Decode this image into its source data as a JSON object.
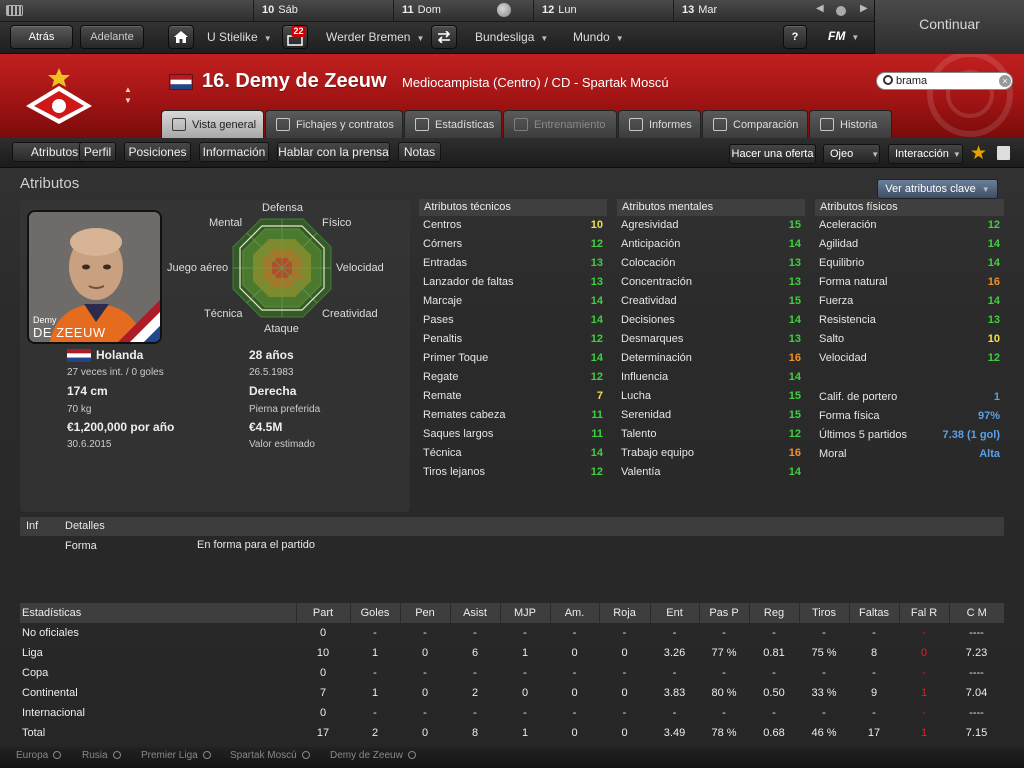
{
  "calendar": {
    "days": [
      {
        "num": "10",
        "label": "Sáb"
      },
      {
        "num": "11",
        "label": "Dom"
      },
      {
        "num": "12",
        "label": "Lun"
      },
      {
        "num": "13",
        "label": "Mar"
      }
    ]
  },
  "nav": {
    "back": "Atrás",
    "forward": "Adelante",
    "manager": "U Stielike",
    "inbox_badge": "22",
    "club": "Werder Bremen",
    "league": "Bundesliga",
    "world": "Mundo",
    "help": "?",
    "logo": "FM",
    "continue": "Continuar"
  },
  "header": {
    "title": "16. Demy de Zeeuw",
    "subtitle": "Mediocampista (Centro) / CD - Spartak Moscú",
    "search_value": "brama",
    "brand_color": "#b81818"
  },
  "tabs": [
    {
      "label": "Vista general",
      "state": "active"
    },
    {
      "label": "Fichajes y contratos",
      "state": "normal"
    },
    {
      "label": "Estadísticas",
      "state": "normal"
    },
    {
      "label": "Entrenamiento",
      "state": "disabled"
    },
    {
      "label": "Informes",
      "state": "normal"
    },
    {
      "label": "Comparación",
      "state": "normal"
    },
    {
      "label": "Historia",
      "state": "normal"
    }
  ],
  "subnav": {
    "items": [
      "Atributos",
      "Perfil",
      "Posiciones",
      "Información",
      "Hablar con la prensa",
      "Notas"
    ],
    "offer": "Hacer una oferta",
    "scout": "Ojeo",
    "interaction": "Interacción"
  },
  "section": {
    "title": "Atributos",
    "key_attr_button": "Ver atributos clave"
  },
  "profile": {
    "photo_first": "Demy",
    "photo_last": "DE ZEEUW",
    "nationality": "Holanda",
    "caps": "27 veces int. / 0 goles",
    "height": "174 cm",
    "weight": "70 kg",
    "wage": "€1,200,000 por año",
    "contract_end": "30.6.2015",
    "age": "28 años",
    "dob": "26.5.1983",
    "foot": "Derecha",
    "foot_label": "Pierna preferida",
    "value": "€4.5M",
    "value_label": "Valor estimado"
  },
  "radar": {
    "labels": {
      "defensa": "Defensa",
      "fisico": "Físico",
      "velocidad": "Velocidad",
      "creatividad": "Creatividad",
      "ataque": "Ataque",
      "tecnica": "Técnica",
      "juego_aereo": "Juego aéreo",
      "mental": "Mental"
    }
  },
  "attributes": {
    "tecnicos_title": "Atributos técnicos",
    "tecnicos": [
      {
        "name": "Centros",
        "value": "10",
        "color": "#f2e04a"
      },
      {
        "name": "Córners",
        "value": "12",
        "color": "#3fcf3f"
      },
      {
        "name": "Entradas",
        "value": "13",
        "color": "#3fcf3f"
      },
      {
        "name": "Lanzador de faltas",
        "value": "13",
        "color": "#3fcf3f"
      },
      {
        "name": "Marcaje",
        "value": "14",
        "color": "#3fcf3f"
      },
      {
        "name": "Pases",
        "value": "14",
        "color": "#3fcf3f"
      },
      {
        "name": "Penaltis",
        "value": "12",
        "color": "#3fcf3f"
      },
      {
        "name": "Primer Toque",
        "value": "14",
        "color": "#3fcf3f"
      },
      {
        "name": "Regate",
        "value": "12",
        "color": "#3fcf3f"
      },
      {
        "name": "Remate",
        "value": "7",
        "color": "#f2e04a"
      },
      {
        "name": "Remates cabeza",
        "value": "11",
        "color": "#3fcf3f"
      },
      {
        "name": "Saques largos",
        "value": "11",
        "color": "#3fcf3f"
      },
      {
        "name": "Técnica",
        "value": "14",
        "color": "#3fcf3f"
      },
      {
        "name": "Tiros lejanos",
        "value": "12",
        "color": "#3fcf3f"
      }
    ],
    "mentales_title": "Atributos mentales",
    "mentales": [
      {
        "name": "Agresividad",
        "value": "15",
        "color": "#3fcf3f"
      },
      {
        "name": "Anticipación",
        "value": "14",
        "color": "#3fcf3f"
      },
      {
        "name": "Colocación",
        "value": "13",
        "color": "#3fcf3f"
      },
      {
        "name": "Concentración",
        "value": "13",
        "color": "#3fcf3f"
      },
      {
        "name": "Creatividad",
        "value": "15",
        "color": "#3fcf3f"
      },
      {
        "name": "Decisiones",
        "value": "14",
        "color": "#3fcf3f"
      },
      {
        "name": "Desmarques",
        "value": "13",
        "color": "#3fcf3f"
      },
      {
        "name": "Determinación",
        "value": "16",
        "color": "#f0902a"
      },
      {
        "name": "Influencia",
        "value": "14",
        "color": "#3fcf3f"
      },
      {
        "name": "Lucha",
        "value": "15",
        "color": "#3fcf3f"
      },
      {
        "name": "Serenidad",
        "value": "15",
        "color": "#3fcf3f"
      },
      {
        "name": "Talento",
        "value": "12",
        "color": "#3fcf3f"
      },
      {
        "name": "Trabajo equipo",
        "value": "16",
        "color": "#f0902a"
      },
      {
        "name": "Valentía",
        "value": "14",
        "color": "#3fcf3f"
      }
    ],
    "fisicos_title": "Atributos físicos",
    "fisicos": [
      {
        "name": "Aceleración",
        "value": "12",
        "color": "#3fcf3f"
      },
      {
        "name": "Agilidad",
        "value": "14",
        "color": "#3fcf3f"
      },
      {
        "name": "Equilibrio",
        "value": "14",
        "color": "#3fcf3f"
      },
      {
        "name": "Forma natural",
        "value": "16",
        "color": "#f0902a"
      },
      {
        "name": "Fuerza",
        "value": "14",
        "color": "#3fcf3f"
      },
      {
        "name": "Resistencia",
        "value": "13",
        "color": "#3fcf3f"
      },
      {
        "name": "Salto",
        "value": "10",
        "color": "#f2e04a"
      },
      {
        "name": "Velocidad",
        "value": "12",
        "color": "#3fcf3f"
      }
    ],
    "extra": [
      {
        "name": "Calif. de portero",
        "value": "1",
        "color": "#5aa0e8"
      },
      {
        "name": "Forma física",
        "value": "97%",
        "color": "#5aa0e8"
      },
      {
        "name": "Últimos 5 partidos",
        "value": "7.38 (1 gol)",
        "color": "#5aa0e8"
      },
      {
        "name": "Moral",
        "value": "Alta",
        "color": "#5aa0e8"
      }
    ]
  },
  "details": {
    "col_inf": "Inf",
    "col_det": "Detalles",
    "label": "Forma",
    "value": "En forma para el partido"
  },
  "stats": {
    "headers": [
      "Estadísticas",
      "Part",
      "Goles",
      "Pen",
      "Asist",
      "MJP",
      "Am.",
      "Roja",
      "Ent",
      "Pas P",
      "Reg",
      "Tiros",
      "Faltas",
      "Fal R",
      "C M"
    ],
    "rows": [
      [
        "No oficiales",
        "0",
        "-",
        "-",
        "-",
        "-",
        "-",
        "-",
        "-",
        "-",
        "-",
        "-",
        "-",
        "-",
        "----"
      ],
      [
        "Liga",
        "10",
        "1",
        "0",
        "6",
        "1",
        "0",
        "0",
        "3.26",
        "77 %",
        "0.81",
        "75 %",
        "8",
        "0",
        "7.23"
      ],
      [
        "Copa",
        "0",
        "-",
        "-",
        "-",
        "-",
        "-",
        "-",
        "-",
        "-",
        "-",
        "-",
        "-",
        "-",
        "----"
      ],
      [
        "Continental",
        "7",
        "1",
        "0",
        "2",
        "0",
        "0",
        "0",
        "3.83",
        "80 %",
        "0.50",
        "33 %",
        "9",
        "1",
        "7.04"
      ],
      [
        "Internacional",
        "0",
        "-",
        "-",
        "-",
        "-",
        "-",
        "-",
        "-",
        "-",
        "-",
        "-",
        "-",
        "-",
        "----"
      ],
      [
        "Total",
        "17",
        "2",
        "0",
        "8",
        "1",
        "0",
        "0",
        "3.49",
        "78 %",
        "0.68",
        "46 %",
        "17",
        "1",
        "7.15"
      ]
    ]
  },
  "breadcrumb": [
    "Europa",
    "Rusia",
    "Premier Liga",
    "Spartak Moscú",
    "Demy de Zeeuw"
  ]
}
